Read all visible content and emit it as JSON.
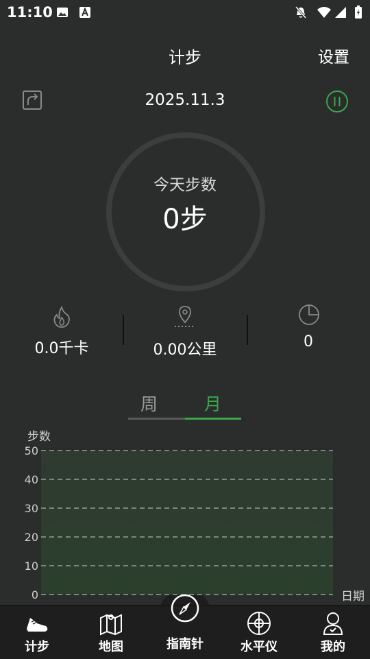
{
  "status_bar": {
    "time": "11:10"
  },
  "header": {
    "title": "计步",
    "settings": "设置"
  },
  "date": "2025.11.3",
  "ring": {
    "label": "今天步数",
    "value": "0步"
  },
  "stats": [
    {
      "icon": "flame-icon",
      "value": "0.0千卡"
    },
    {
      "icon": "location-pin-icon",
      "value": "0.00公里"
    },
    {
      "icon": "pie-clock-icon",
      "value": "0"
    }
  ],
  "tabs": {
    "week": "周",
    "month": "月",
    "selected": "month"
  },
  "colors": {
    "accent": "#3aa84a",
    "background": "#2b2c2c",
    "nav": "#1e1e1e"
  },
  "chart_data": {
    "type": "bar",
    "ylabel": "步数",
    "xlabel": "日期",
    "ylim": [
      0,
      50
    ],
    "yticks": [
      0,
      10,
      20,
      30,
      40,
      50
    ],
    "grid": true,
    "categories": [],
    "values": []
  },
  "nav": [
    {
      "label": "计步",
      "icon": "shoe-icon",
      "active": true
    },
    {
      "label": "地图",
      "icon": "map-icon"
    },
    {
      "label": "指南针",
      "icon": "compass-icon"
    },
    {
      "label": "水平仪",
      "icon": "level-target-icon"
    },
    {
      "label": "我的",
      "icon": "profile-icon"
    }
  ]
}
